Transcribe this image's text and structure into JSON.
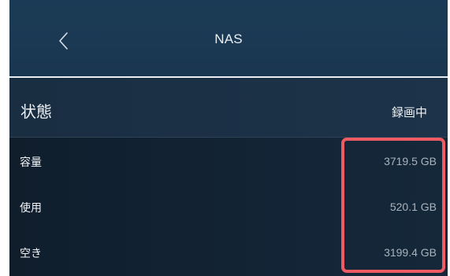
{
  "header": {
    "title": "NAS",
    "back_icon": "chevron-left-icon"
  },
  "status": {
    "label": "状態",
    "value": "録画中"
  },
  "info": {
    "rows": [
      {
        "label": "容量",
        "value": "3719.5 GB"
      },
      {
        "label": "使用",
        "value": "520.1 GB"
      },
      {
        "label": "空き",
        "value": "3199.4 GB"
      }
    ]
  },
  "colors": {
    "header_bg": "#1b3a55",
    "divider": "#e9eef2",
    "list_bg": "#132436",
    "highlight": "#f05a63",
    "value_text": "#a9b3bd"
  }
}
